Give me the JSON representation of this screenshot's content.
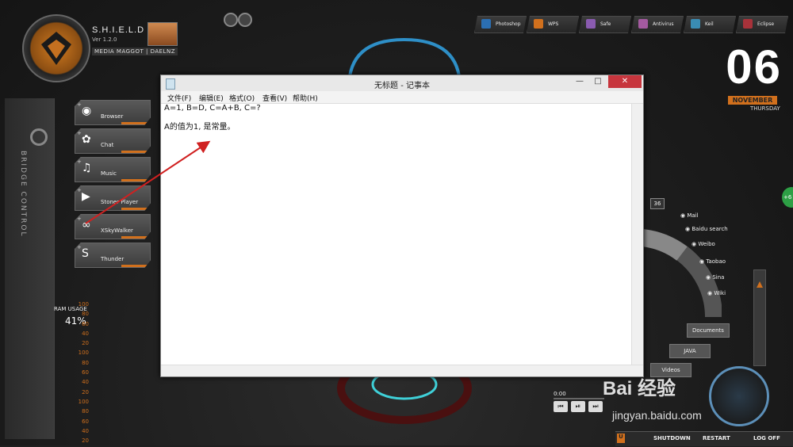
{
  "header": {
    "os_title": "S.H.I.E.L.D OS",
    "version": "Ver 1.2.0",
    "credits": "MEDIA MAGGOT | DAELNZ"
  },
  "top_apps": [
    {
      "label": "Photoshop",
      "color": "#2b6fb3"
    },
    {
      "label": "WPS",
      "color": "#d1701d"
    },
    {
      "label": "Safe",
      "color": "#8a5bb0"
    },
    {
      "label": "Antivirus",
      "color": "#a45aa0"
    },
    {
      "label": "Keil",
      "color": "#3a8cb3"
    },
    {
      "label": "Eclipse",
      "color": "#a8323a"
    }
  ],
  "date": {
    "day": "06",
    "month": "NOVEMBER",
    "weekday": "THURSDAY"
  },
  "sidebar": {
    "bridge_label": "BRIDGE CONTROL",
    "items": [
      {
        "label": "Browser",
        "icon": "◉"
      },
      {
        "label": "Chat",
        "icon": "✿"
      },
      {
        "label": "Music",
        "icon": "♫"
      },
      {
        "label": "Stoner Player",
        "icon": "▶"
      },
      {
        "label": "XSkyWalker",
        "icon": "∞"
      },
      {
        "label": "Thunder",
        "icon": "S"
      }
    ]
  },
  "ram": {
    "label": "RAM USAGE",
    "value": "41%",
    "scale": [
      "100",
      "80",
      "60",
      "40",
      "20",
      "100",
      "80",
      "60",
      "40",
      "20",
      "100",
      "80",
      "60",
      "40",
      "20"
    ]
  },
  "notepad": {
    "title": "无标题 - 记事本",
    "menu": [
      "文件(F)",
      "编辑(E)",
      "格式(O)",
      "查看(V)",
      "帮助(H)"
    ],
    "lines": [
      "A=1, B=D, C=A+B, C=?",
      "",
      "A的值为1, 是常量。"
    ],
    "min": "—",
    "max": "□",
    "close": "✕"
  },
  "arc_menu": {
    "count": "36",
    "items": [
      "Mail",
      "Baidu search",
      "Weibo",
      "Taobao",
      "Sina",
      "Wiki"
    ],
    "documents": "Documents",
    "java": "JAVA",
    "videos": "Videos"
  },
  "player": {
    "time": "0:00",
    "prev": "⏮",
    "play": "⏯",
    "next": "⏭"
  },
  "bottom": {
    "shutdown": "SHUTDOWN",
    "restart": "RESTART",
    "logoff": "LOG OFF"
  },
  "watermark": {
    "brand": "Bai 经验",
    "url": "jingyan.baidu.com"
  }
}
